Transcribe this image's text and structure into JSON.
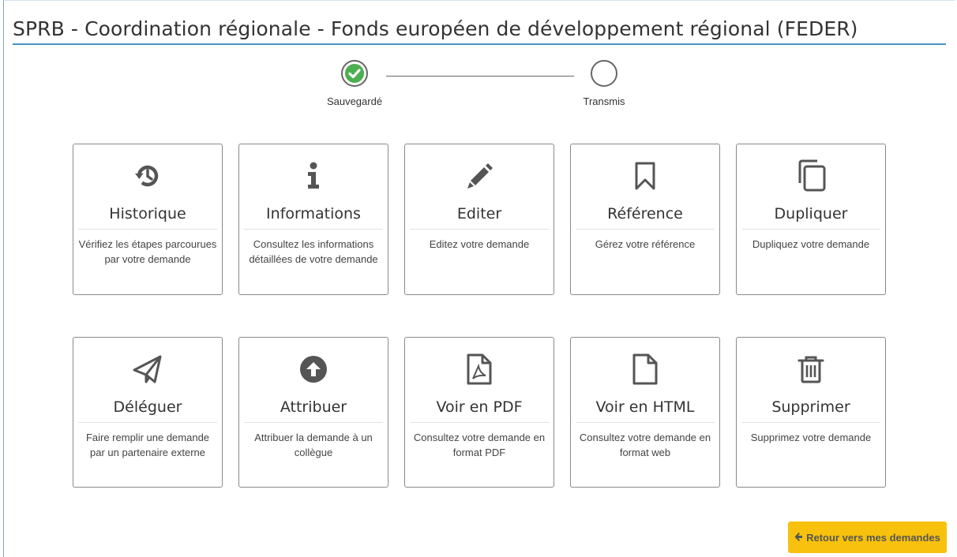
{
  "page_title": "SPRB - Coordination régionale - Fonds européen de développement régional (FEDER)",
  "stepper": {
    "steps": [
      {
        "label": "Sauvegardé",
        "state": "done"
      },
      {
        "label": "Transmis",
        "state": "pending"
      }
    ],
    "done_color": "#4caf50"
  },
  "tiles": [
    {
      "title": "Historique",
      "description": "Vérifiez les étapes parcourues par votre demande",
      "icon": "history-icon"
    },
    {
      "title": "Informations",
      "description": "Consultez les informations détaillées de votre demande",
      "icon": "info-icon"
    },
    {
      "title": "Editer",
      "description": "Editez votre demande",
      "icon": "pencil-icon"
    },
    {
      "title": "Référence",
      "description": "Gérez votre référence",
      "icon": "bookmark-icon"
    },
    {
      "title": "Dupliquer",
      "description": "Dupliquez votre demande",
      "icon": "copy-icon"
    },
    {
      "title": "Déléguer",
      "description": "Faire remplir une demande par un partenaire externe",
      "icon": "paper-plane-icon"
    },
    {
      "title": "Attribuer",
      "description": "Attribuer la demande à un collègue",
      "icon": "arrow-circle-up-icon"
    },
    {
      "title": "Voir en PDF",
      "description": "Consultez votre demande en format PDF",
      "icon": "pdf-file-icon"
    },
    {
      "title": "Voir en HTML",
      "description": "Consultez votre demande en format web",
      "icon": "file-icon"
    },
    {
      "title": "Supprimer",
      "description": "Supprimez votre demande",
      "icon": "trash-icon"
    }
  ],
  "back_button": {
    "label": "Retour vers mes demandes",
    "icon": "arrow-left-icon"
  },
  "colors": {
    "accent_blue": "#4a90c2",
    "button_yellow": "#f7c10d",
    "icon_gray": "#555555"
  }
}
